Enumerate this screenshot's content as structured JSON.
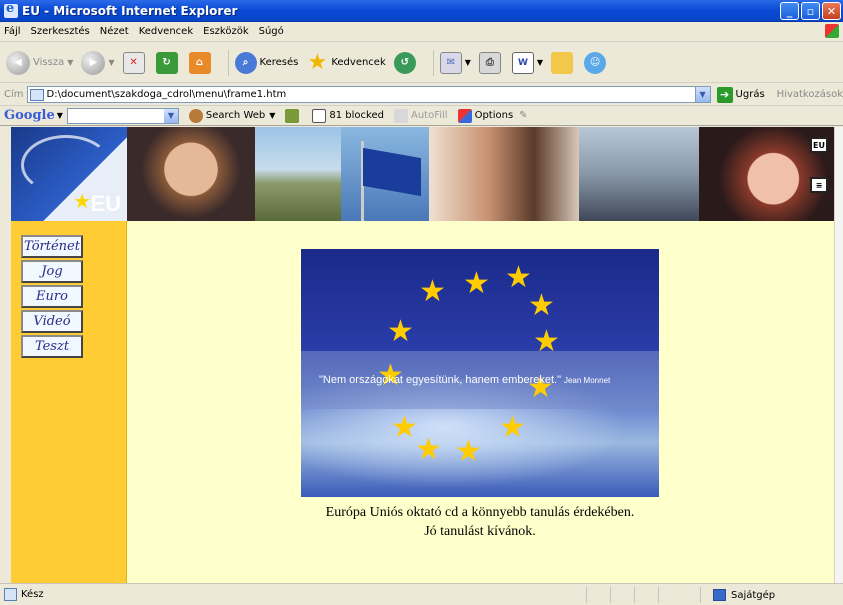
{
  "window": {
    "title": "EU - Microsoft Internet Explorer"
  },
  "menubar": {
    "items": [
      "Fájl",
      "Szerkesztés",
      "Nézet",
      "Kedvencek",
      "Eszközök",
      "Súgó"
    ]
  },
  "toolbar": {
    "back_label": "Vissza",
    "search_label": "Keresés",
    "favorites_label": "Kedvencek"
  },
  "address": {
    "label": "Cím",
    "url": "D:\\document\\szakdoga_cdrol\\menu\\frame1.htm",
    "go_label": "Ugrás",
    "links_label": "Hivatkozások"
  },
  "googlebar": {
    "logo": "Google",
    "search_web_label": "Search Web",
    "blocked_label": "81 blocked",
    "autofill_label": "AutoFill",
    "options_label": "Options"
  },
  "banner": {
    "logo_text": "EU",
    "icon_top": "EU"
  },
  "nav": {
    "items": [
      "Történet",
      "Jog",
      "Euro",
      "Videó",
      "Teszt"
    ]
  },
  "hero": {
    "quote": "\"Nem országokat egyesítünk, hanem embereket.\"",
    "author": "Jean Monnet"
  },
  "caption": {
    "line1": "Európa Uniós oktató cd a könnyebb tanulás érdekében.",
    "line2": "Jó tanulást kívánok."
  },
  "status": {
    "text": "Kész",
    "zone": "Sajátgép"
  }
}
